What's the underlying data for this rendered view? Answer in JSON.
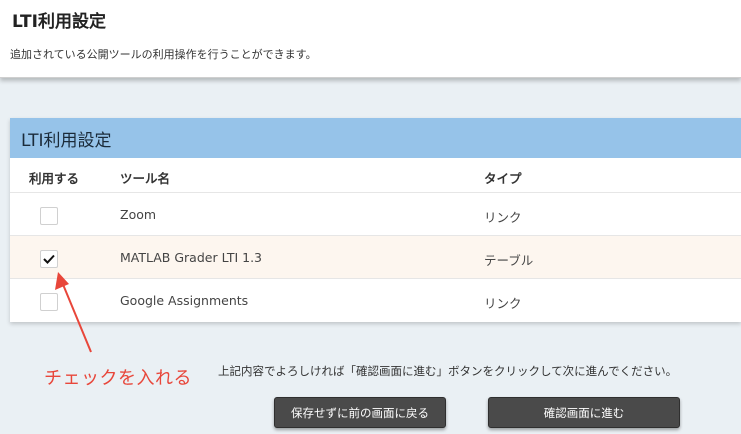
{
  "header": {
    "title": "LTI利用設定",
    "description": "追加されている公開ツールの利用操作を行うことができます。"
  },
  "panel": {
    "title": "LTI利用設定",
    "columns": {
      "use": "利用する",
      "tool_name": "ツール名",
      "type": "タイプ"
    },
    "rows": [
      {
        "checked": false,
        "tool_name": "Zoom",
        "type": "リンク"
      },
      {
        "checked": true,
        "tool_name": "MATLAB Grader LTI 1.3",
        "type": "テーブル"
      },
      {
        "checked": false,
        "tool_name": "Google Assignments",
        "type": "リンク"
      }
    ]
  },
  "annotation": {
    "text": "チェックを入れる",
    "color": "#e8463a"
  },
  "footer": {
    "instruction": "上記内容でよろしければ「確認画面に進む」ボタンをクリックして次に進んでください。",
    "back_button": "保存せずに前の画面に戻る",
    "next_button": "確認画面に進む"
  },
  "colors": {
    "panel_header": "#96c3e9",
    "background": "#eaf0f4",
    "button": "#4a4a4a"
  }
}
